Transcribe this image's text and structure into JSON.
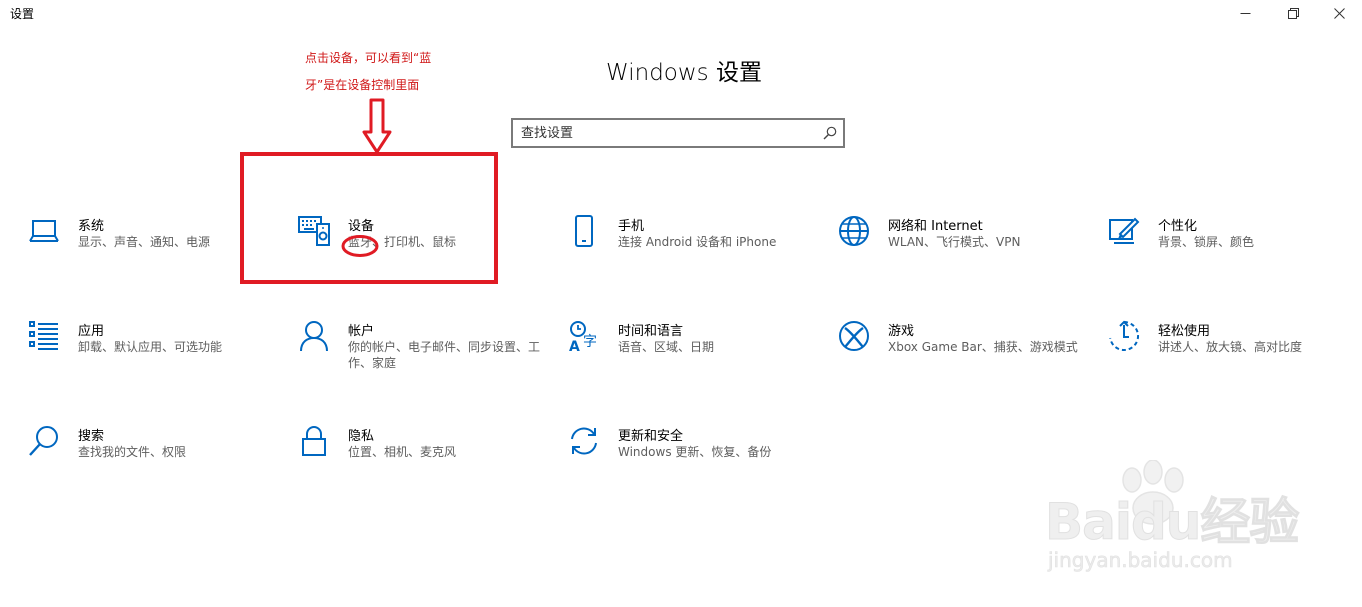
{
  "window": {
    "title": "设置"
  },
  "page_title": "Windows 设置",
  "search": {
    "placeholder": "查找设置"
  },
  "tiles": [
    {
      "title": "系统",
      "desc": "显示、声音、通知、电源",
      "icon": "laptop-icon"
    },
    {
      "title": "设备",
      "desc": "蓝牙、打印机、鼠标",
      "icon": "devices-icon"
    },
    {
      "title": "手机",
      "desc": "连接 Android 设备和 iPhone",
      "icon": "phone-icon"
    },
    {
      "title": "网络和 Internet",
      "desc": "WLAN、飞行模式、VPN",
      "icon": "globe-icon"
    },
    {
      "title": "个性化",
      "desc": "背景、锁屏、颜色",
      "icon": "personalization-icon"
    },
    {
      "title": "应用",
      "desc": "卸载、默认应用、可选功能",
      "icon": "apps-list-icon"
    },
    {
      "title": "帐户",
      "desc": "你的帐户、电子邮件、同步设置、工作、家庭",
      "icon": "person-icon"
    },
    {
      "title": "时间和语言",
      "desc": "语音、区域、日期",
      "icon": "time-language-icon"
    },
    {
      "title": "游戏",
      "desc": "Xbox Game Bar、捕获、游戏模式",
      "icon": "xbox-icon"
    },
    {
      "title": "轻松使用",
      "desc": "讲述人、放大镜、高对比度",
      "icon": "ease-of-access-icon"
    },
    {
      "title": "搜索",
      "desc": "查找我的文件、权限",
      "icon": "search-icon"
    },
    {
      "title": "隐私",
      "desc": "位置、相机、麦克风",
      "icon": "lock-icon"
    },
    {
      "title": "更新和安全",
      "desc": "Windows 更新、恢复、备份",
      "icon": "sync-icon"
    }
  ],
  "annotation": {
    "note": "点击设备，可以看到“蓝牙”是在设备控制里面",
    "color": "#e01b24"
  },
  "watermark": {
    "logo": "Baidu经验",
    "url": "jingyan.baidu.com"
  },
  "colors": {
    "accent": "#0067c0",
    "annotation": "#e01b24"
  }
}
